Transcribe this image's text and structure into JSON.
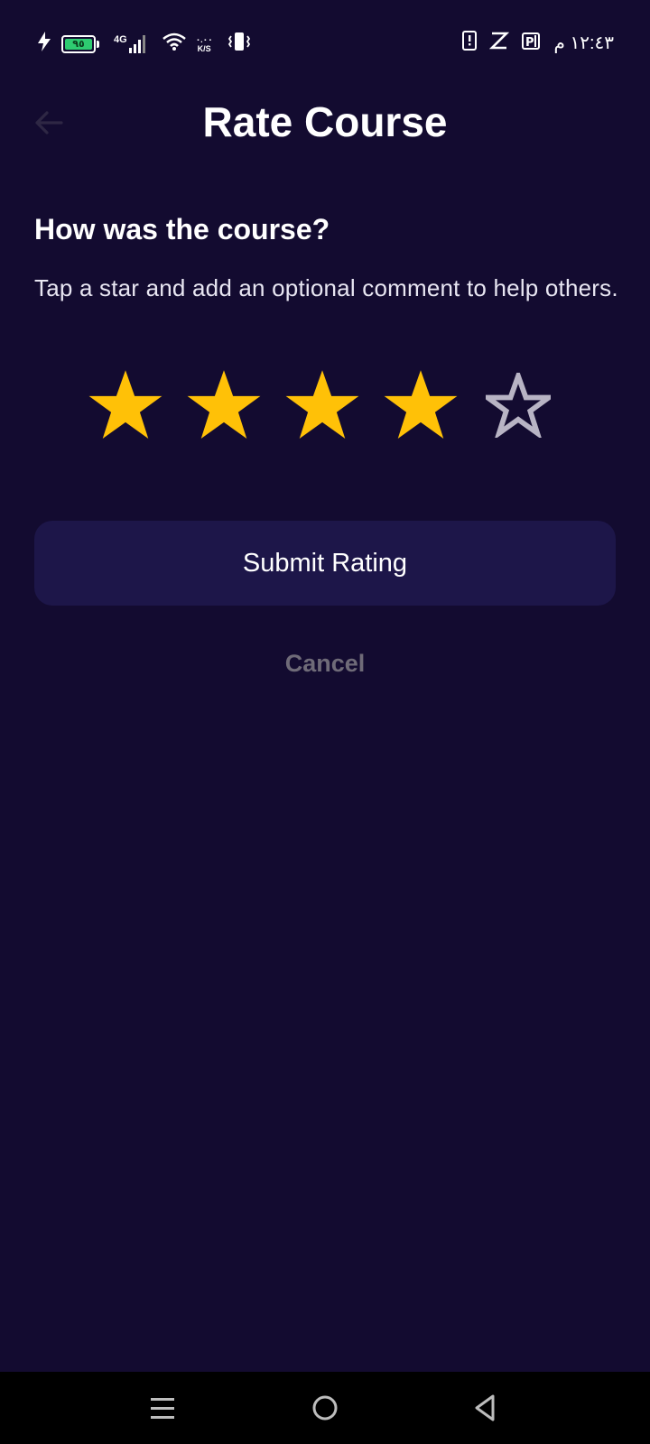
{
  "status_bar": {
    "battery_level": "٩٥",
    "network": "4G",
    "speed_value": "٠.٠٠",
    "speed_unit": "K/S",
    "time": "١٢:٤٣ م"
  },
  "header": {
    "title": "Rate Course"
  },
  "rating": {
    "question": "How was the course?",
    "help_text": "Tap a star and add an optional comment to help others.",
    "selected": 4,
    "max": 5,
    "filled_color": "#ffc107",
    "empty_color": "#b8b4c4"
  },
  "actions": {
    "submit_label": "Submit Rating",
    "cancel_label": "Cancel"
  },
  "colors": {
    "background": "#130b30",
    "submit_bg": "#1d1649",
    "cancel_text": "#6f6b78"
  }
}
